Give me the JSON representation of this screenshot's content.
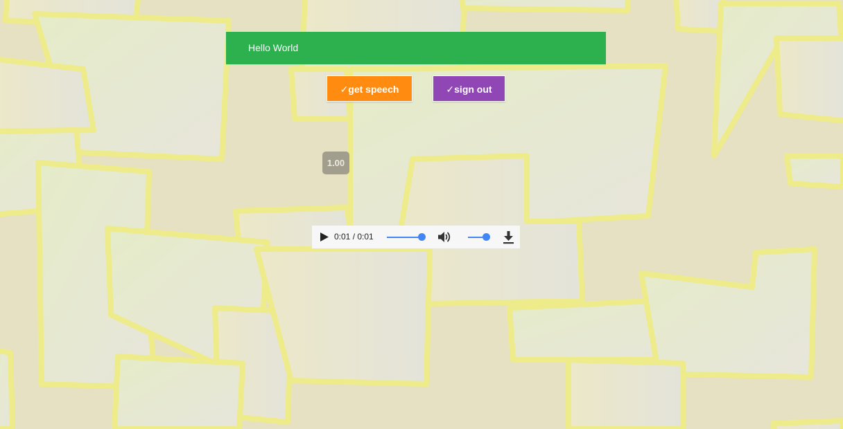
{
  "header": {
    "title": "Hello World",
    "color": "#2db14f"
  },
  "buttons": {
    "get_speech": {
      "label": "✓get speech",
      "color": "#ff8c11"
    },
    "sign_out": {
      "label": "✓sign out",
      "color": "#9046b5"
    }
  },
  "rate": {
    "value": "1.00"
  },
  "player": {
    "time": "0:01 / 0:01",
    "progress": 1.0,
    "volume": 1.0,
    "accent": "#4285f4",
    "icons": [
      "play-icon",
      "volume-icon",
      "download-icon"
    ]
  },
  "theme": {
    "note_fill": "#e7e5da",
    "note_border": "#eeeb8a"
  }
}
